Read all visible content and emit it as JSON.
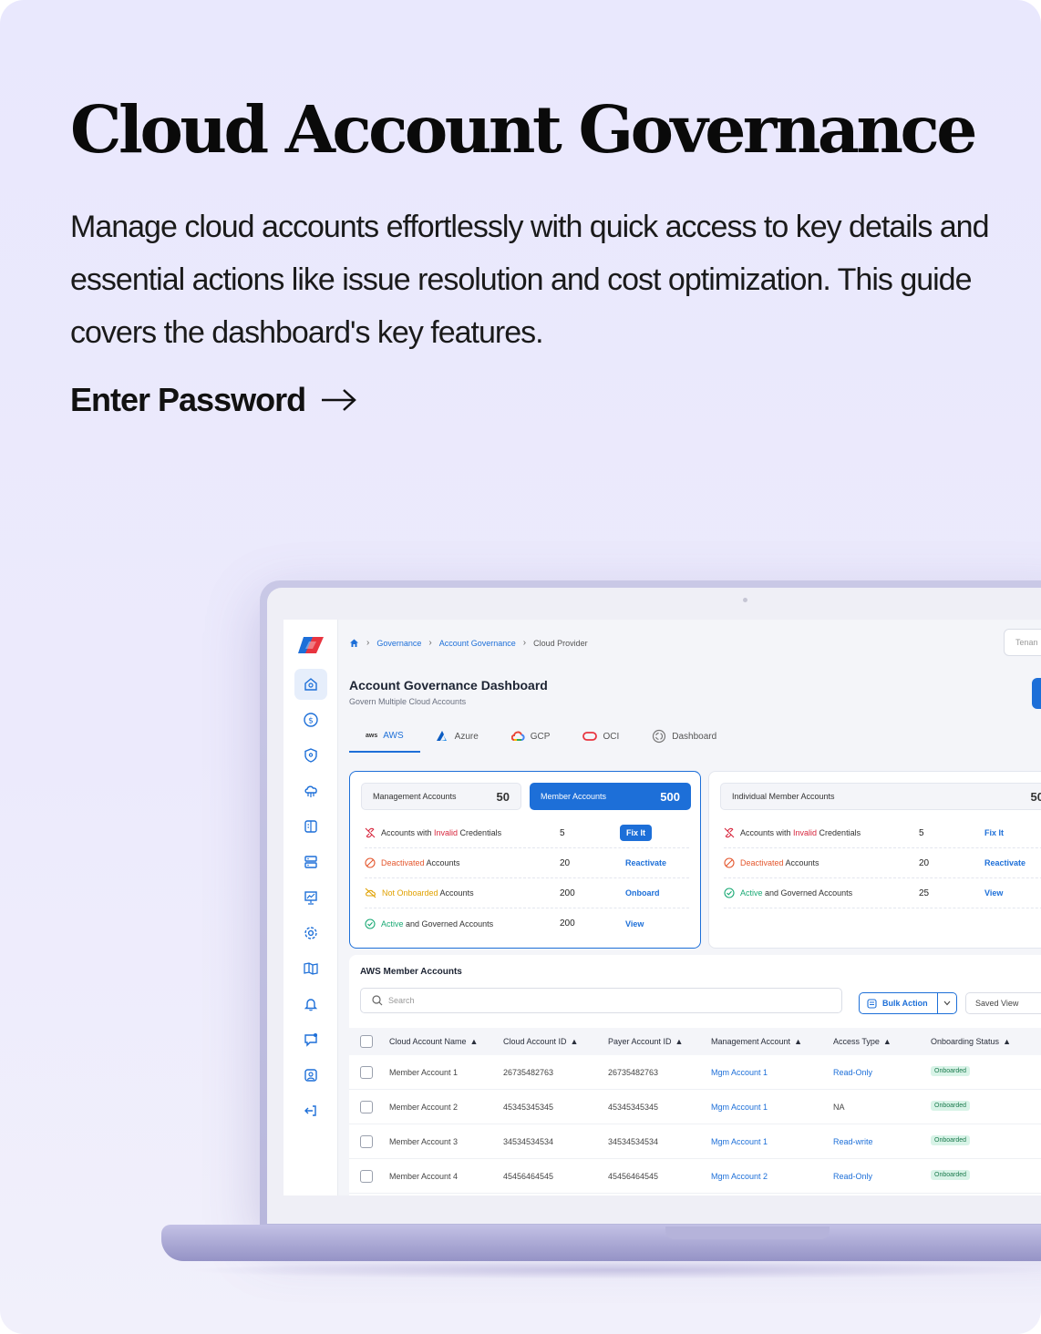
{
  "hero": {
    "title": "Cloud Account Governance",
    "description": "Manage cloud accounts effortlessly with quick access to key details and essential actions like issue resolution and cost optimization. This guide covers the dashboard's key features.",
    "cta": "Enter Password"
  },
  "app": {
    "breadcrumb": {
      "home_icon": "home-icon",
      "items": [
        "Governance",
        "Account Governance",
        "Cloud Provider"
      ]
    },
    "tenant_placeholder": "Tenan",
    "title": "Account Governance Dashboard",
    "subtitle": "Govern Multiple Cloud Accounts",
    "tabs": [
      {
        "label": "AWS",
        "mini": "aws",
        "icon": "aws-icon",
        "active": true
      },
      {
        "label": "Azure",
        "icon": "azure-icon"
      },
      {
        "label": "GCP",
        "icon": "gcp-icon"
      },
      {
        "label": "OCI",
        "icon": "oci-icon"
      },
      {
        "label": "Dashboard",
        "icon": "dashboard-icon"
      }
    ],
    "sidebar_icons": [
      "home-icon",
      "dollar-icon",
      "shield-icon",
      "cloud-network-icon",
      "split-panel-icon",
      "server-icon",
      "presentation-chart-icon",
      "gear-icon",
      "book-icon",
      "bell-icon",
      "chat-icon",
      "user-badge-icon",
      "logout-icon"
    ],
    "left_summary": {
      "management": {
        "label": "Management Accounts",
        "value": "50"
      },
      "member": {
        "label": "Member Accounts",
        "value": "500"
      },
      "rows": [
        {
          "pre": "Accounts with ",
          "highlight": "Invalid",
          "post": " Credentials",
          "value": "5",
          "action": "Fix It"
        },
        {
          "pre": "",
          "highlight": "Deactivated",
          "post": " Accounts",
          "value": "20",
          "action": "Reactivate"
        },
        {
          "pre": "",
          "highlight": "Not Onboarded",
          "post": " Accounts",
          "value": "200",
          "action": "Onboard"
        },
        {
          "pre": "",
          "highlight": "Active",
          "post": " and Governed Accounts",
          "value": "200",
          "action": "View"
        }
      ]
    },
    "right_summary": {
      "individual": {
        "label": "Individual Member Accounts",
        "value": "50"
      },
      "rows": [
        {
          "pre": "Accounts with ",
          "highlight": "Invalid",
          "post": " Credentials",
          "value": "5",
          "action": "Fix It"
        },
        {
          "pre": "",
          "highlight": "Deactivated",
          "post": " Accounts",
          "value": "20",
          "action": "Reactivate"
        },
        {
          "pre": "",
          "highlight": "Active",
          "post": " and Governed Accounts",
          "value": "25",
          "action": "View"
        }
      ]
    },
    "members": {
      "title": "AWS Member Accounts",
      "search_placeholder": "Search",
      "bulk_action": "Bulk Action",
      "saved_view": "Saved View",
      "columns": [
        "Cloud Account Name",
        "Cloud Account ID",
        "Payer Account ID",
        "Management Account",
        "Access Type",
        "Onboarding Status"
      ],
      "rows": [
        {
          "name": "Member Account 1",
          "cloud_id": "26735482763",
          "payer_id": "26735482763",
          "mgmt": "Mgm Account 1",
          "access": "Read-Only",
          "status": "Onboarded"
        },
        {
          "name": "Member Account 2",
          "cloud_id": "45345345345",
          "payer_id": "45345345345",
          "mgmt": "Mgm Account 1",
          "access": "NA",
          "status": "Onboarded"
        },
        {
          "name": "Member Account 3",
          "cloud_id": "34534534534",
          "payer_id": "34534534534",
          "mgmt": "Mgm Account 1",
          "access": "Read-write",
          "status": "Onboarded"
        },
        {
          "name": "Member Account 4",
          "cloud_id": "45456464545",
          "payer_id": "45456464545",
          "mgmt": "Mgm Account 2",
          "access": "Read-Only",
          "status": "Onboarded"
        }
      ]
    }
  },
  "colors": {
    "primary": "#1d6fd8",
    "background": "#e9e8fd",
    "invalid": "#d7263d",
    "deactivated": "#e4572e",
    "not_onboarded": "#e0a100",
    "active": "#19a974"
  }
}
